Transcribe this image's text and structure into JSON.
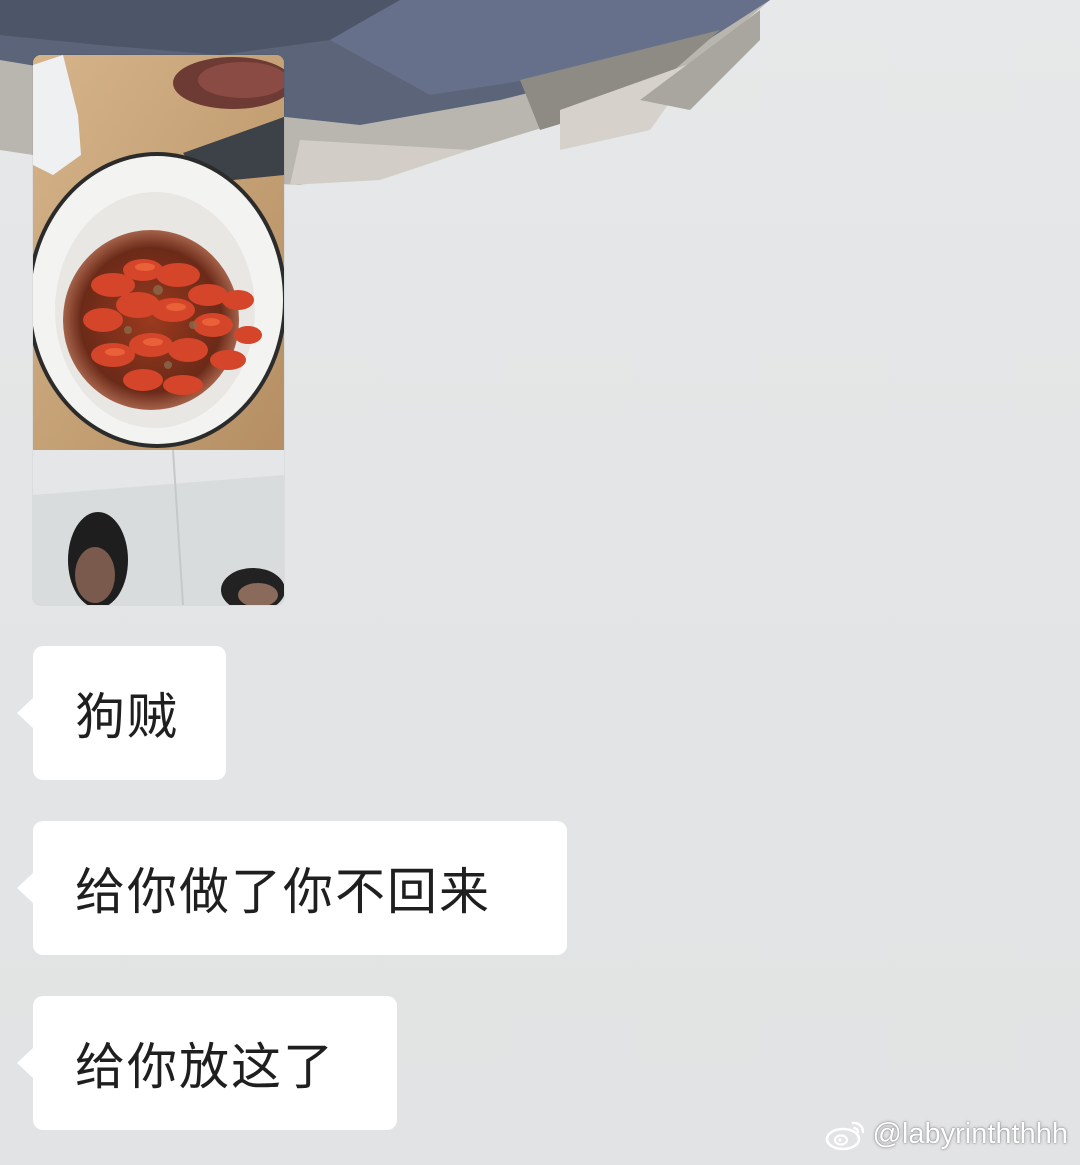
{
  "chat": {
    "photo": {
      "description_icon": "photo-thumbnail"
    },
    "messages": [
      {
        "text": "狗贼"
      },
      {
        "text": "给你做了你不回来"
      },
      {
        "text": "给你放这了"
      }
    ]
  },
  "watermark": {
    "handle": "@labyrinththhh",
    "logo_icon": "weibo-logo-icon"
  },
  "colors": {
    "background": "#e2e4e5",
    "bubble": "#ffffff",
    "text": "#1f1f1f"
  }
}
